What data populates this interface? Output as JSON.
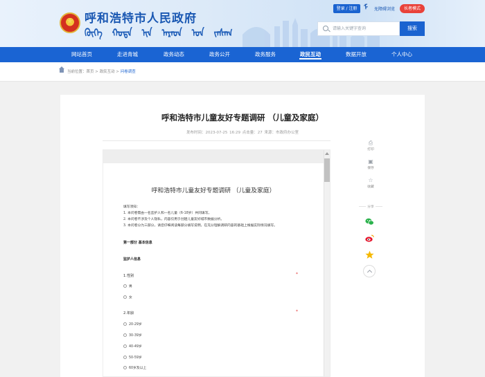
{
  "header": {
    "site_title": "呼和浩特市人民政府",
    "mongolian_title": [
      "ᠬᠥᠬᠡ",
      "ᠬᠣᠲᠠ",
      "ᠢᠨ",
      "ᠠᠷᠠᠳ",
      "ᠤᠨ",
      "ᠵᠠᠰᠠᠭ"
    ],
    "login_label": "登录 / 注册",
    "mongolian_version_glyph": "ᠮ",
    "accessibility_label": "无障碍浏览",
    "elder_mode_label": "长者模式",
    "search_placeholder": "请输入关键字查询",
    "search_button": "搜索"
  },
  "nav": {
    "items": [
      "网站首页",
      "走进青城",
      "政务动态",
      "政务公开",
      "政务服务",
      "政民互动",
      "数据开放",
      "个人中心"
    ],
    "active": "政民互动"
  },
  "breadcrumb": {
    "prefix": "当前位置：",
    "home": "首页",
    "sep1": " > ",
    "section": "政民互动",
    "sep2": " > ",
    "current": "问卷调查"
  },
  "article": {
    "title": "呼和浩特市儿童友好专题调研 （儿童及家庭）",
    "meta": "发布时间：2023-07-25 16:29      点击量：27      来源：市政府办公室"
  },
  "survey": {
    "title": "呼和浩特市儿童友好专题调研 （儿童及家庭）",
    "notice": [
      "填写须知：",
      "1. 本问卷需由一名监护人和一名儿童（6-18岁）共同填写。",
      "2. 本问卷不涉及个人隐私，内容仅用于创建儿童友好城市数据分析。",
      "3. 本问卷分为三部分，请您仔细阅读每部分填写说明，在充分理解调研内容的基础上根据实际情况填写。"
    ],
    "part1": "第一部分 基本信息",
    "subsection": "监护人信息",
    "q1": {
      "label": "1.性别",
      "required": "*",
      "options": [
        "男",
        "女"
      ]
    },
    "q2": {
      "label": "2.年龄",
      "required": "*",
      "options": [
        "20-29岁",
        "30-39岁",
        "40-49岁",
        "50-59岁",
        "60岁及以上"
      ]
    }
  },
  "tools": {
    "print": {
      "icon": "print-icon",
      "label": "打印"
    },
    "save": {
      "icon": "save-icon",
      "label": "保存"
    },
    "favorite": {
      "icon": "favorite-icon",
      "label": "收藏"
    },
    "share_label": "分享"
  },
  "colors": {
    "brand_blue": "#1a64d3",
    "elder_red": "#e9423a",
    "wechat_green": "#2bb24c",
    "weibo_red": "#e6162d",
    "qzone_yellow": "#f5b800"
  }
}
